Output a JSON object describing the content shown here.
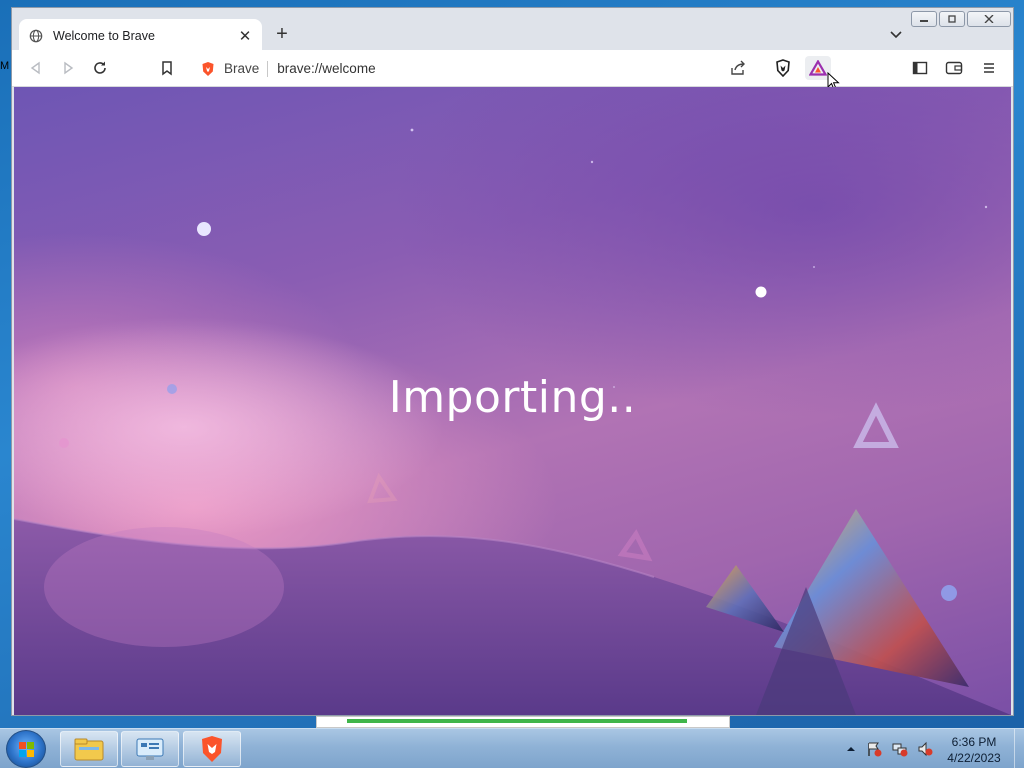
{
  "browser": {
    "tab": {
      "title": "Welcome to Brave"
    },
    "omnibox": {
      "site_chip": "Brave",
      "url": "brave://welcome"
    },
    "window_controls": {
      "minimize": "minimize",
      "restore": "restore",
      "close": "close"
    }
  },
  "page": {
    "headline": "Importing.."
  },
  "taskbar": {
    "clock": {
      "time": "6:36 PM",
      "date": "4/22/2023"
    },
    "pinned": [
      "explorer",
      "control-panel",
      "brave"
    ]
  },
  "colors": {
    "accent_brave": "#fb542b",
    "bat_triangle": "#9b2fae",
    "page_gradient_top": "#6e56b4",
    "page_gradient_mid": "#b173b4"
  }
}
